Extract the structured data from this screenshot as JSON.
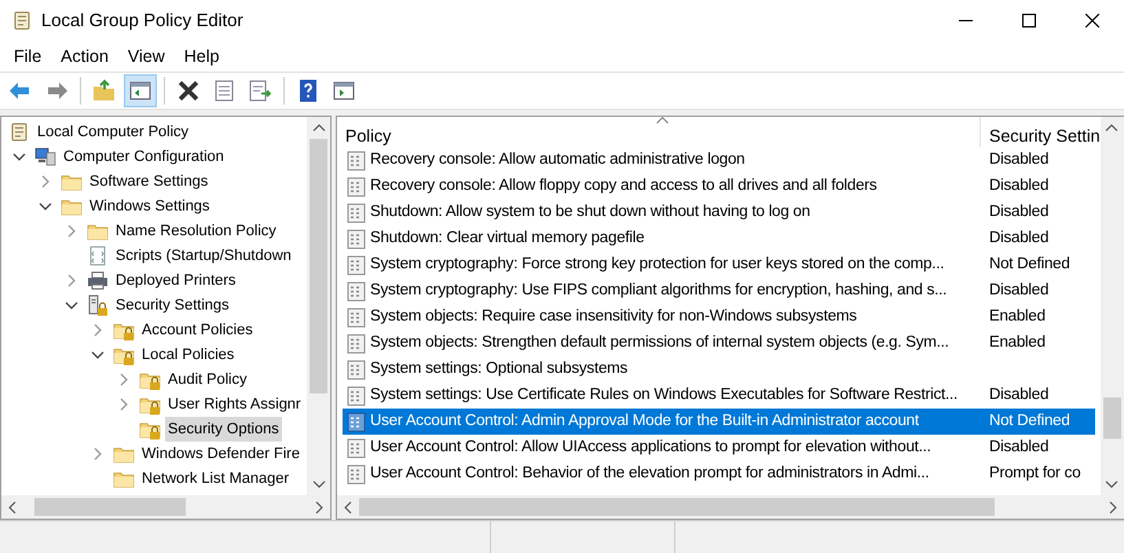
{
  "window": {
    "title": "Local Group Policy Editor"
  },
  "menu": [
    "File",
    "Action",
    "View",
    "Help"
  ],
  "toolbar": [
    {
      "kind": "back",
      "disabled": false
    },
    {
      "kind": "forward",
      "disabled": true
    },
    {
      "kind": "sep"
    },
    {
      "kind": "up",
      "disabled": false
    },
    {
      "kind": "showhide",
      "disabled": false,
      "selected": true
    },
    {
      "kind": "sep"
    },
    {
      "kind": "delete",
      "disabled": false
    },
    {
      "kind": "properties",
      "disabled": false
    },
    {
      "kind": "export",
      "disabled": false
    },
    {
      "kind": "sep"
    },
    {
      "kind": "help",
      "disabled": false
    },
    {
      "kind": "actionpane",
      "disabled": false
    }
  ],
  "tree": [
    {
      "label": "Local Computer Policy",
      "kind": "policy",
      "selected": false,
      "children": [
        {
          "label": "Computer Configuration",
          "kind": "computer",
          "expanded": true,
          "selected": false,
          "children": [
            {
              "label": "Software Settings",
              "kind": "folder",
              "expanded": false,
              "selected": false
            },
            {
              "label": "Windows Settings",
              "kind": "folder",
              "expanded": true,
              "selected": false,
              "children": [
                {
                  "label": "Name Resolution Policy",
                  "kind": "folder",
                  "expanded": false,
                  "selected": false
                },
                {
                  "label": "Scripts (Startup/Shutdown",
                  "kind": "script",
                  "selected": false
                },
                {
                  "label": "Deployed Printers",
                  "kind": "printer",
                  "expanded": false,
                  "selected": false
                },
                {
                  "label": "Security Settings",
                  "kind": "security",
                  "expanded": true,
                  "selected": false,
                  "children": [
                    {
                      "label": "Account Policies",
                      "kind": "lockfolder",
                      "expanded": false,
                      "selected": false
                    },
                    {
                      "label": "Local Policies",
                      "kind": "lockfolder",
                      "expanded": true,
                      "selected": false,
                      "children": [
                        {
                          "label": "Audit Policy",
                          "kind": "lockfolder",
                          "expanded": false,
                          "selected": false
                        },
                        {
                          "label": "User Rights Assignr",
                          "kind": "lockfolder",
                          "expanded": false,
                          "selected": false
                        },
                        {
                          "label": "Security Options",
                          "kind": "lockfolder",
                          "selected": true
                        }
                      ]
                    },
                    {
                      "label": "Windows Defender Fire",
                      "kind": "folder",
                      "expanded": false,
                      "selected": false
                    },
                    {
                      "label": "Network List Manager",
                      "kind": "folder",
                      "selected": false
                    }
                  ]
                }
              ]
            }
          ]
        }
      ]
    }
  ],
  "table": {
    "columns": [
      "Policy",
      "Security Settin"
    ],
    "rows": [
      {
        "policy": "Recovery console: Allow automatic administrative logon",
        "setting": "Disabled",
        "selected": false
      },
      {
        "policy": "Recovery console: Allow floppy copy and access to all drives and all folders",
        "setting": "Disabled",
        "selected": false
      },
      {
        "policy": "Shutdown: Allow system to be shut down without having to log on",
        "setting": "Disabled",
        "selected": false
      },
      {
        "policy": "Shutdown: Clear virtual memory pagefile",
        "setting": "Disabled",
        "selected": false
      },
      {
        "policy": "System cryptography: Force strong key protection for user keys stored on the comp...",
        "setting": "Not Defined",
        "selected": false
      },
      {
        "policy": "System cryptography: Use FIPS compliant algorithms for encryption, hashing, and s...",
        "setting": "Disabled",
        "selected": false
      },
      {
        "policy": "System objects: Require case insensitivity for non-Windows subsystems",
        "setting": "Enabled",
        "selected": false
      },
      {
        "policy": "System objects: Strengthen default permissions of internal system objects (e.g. Sym...",
        "setting": "Enabled",
        "selected": false
      },
      {
        "policy": "System settings: Optional subsystems",
        "selected": false
      },
      {
        "policy": "System settings: Use Certificate Rules on Windows Executables for Software Restrict...",
        "setting": "Disabled",
        "selected": false
      },
      {
        "policy": "User Account Control: Admin Approval Mode for the Built-in Administrator account",
        "setting": "Not Defined",
        "selected": true
      },
      {
        "policy": "User Account Control: Allow UIAccess applications to prompt for elevation without...",
        "setting": "Disabled",
        "selected": false
      },
      {
        "policy": "User Account Control: Behavior of the elevation prompt for administrators in Admi...",
        "setting": "Prompt for co",
        "selected": false
      }
    ]
  }
}
